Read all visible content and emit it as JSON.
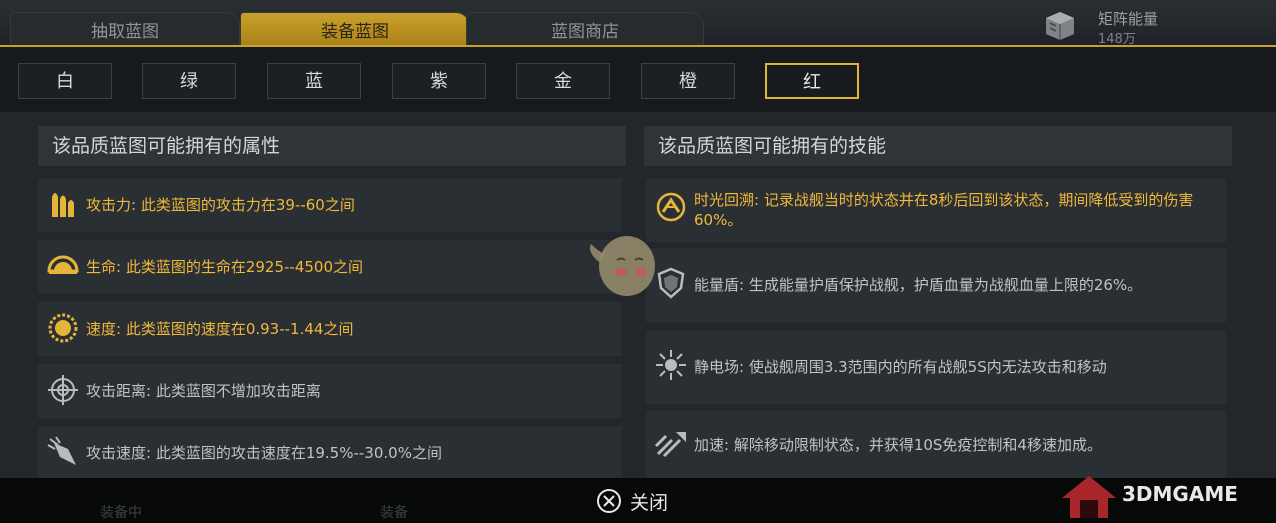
{
  "top_tabs": [
    {
      "label": "抽取蓝图",
      "active": false
    },
    {
      "label": "装备蓝图",
      "active": true
    },
    {
      "label": "蓝图商店",
      "active": false
    }
  ],
  "energy": {
    "label": "矩阵能量",
    "value": "148万",
    "icon": "energy-cube-icon"
  },
  "quality_tabs": [
    {
      "label": "白",
      "active": false
    },
    {
      "label": "绿",
      "active": false
    },
    {
      "label": "蓝",
      "active": false
    },
    {
      "label": "紫",
      "active": false
    },
    {
      "label": "金",
      "active": false
    },
    {
      "label": "橙",
      "active": false
    },
    {
      "label": "红",
      "active": true
    }
  ],
  "attributes": {
    "title": "该品质蓝图可能拥有的属性",
    "items": [
      {
        "icon": "bullets-icon",
        "text": "攻击力: 此类蓝图的攻击力在39--60之间",
        "highlight": true
      },
      {
        "icon": "life-icon",
        "text": "生命: 此类蓝图的生命在2925--4500之间",
        "highlight": true
      },
      {
        "icon": "speed-icon",
        "text": "速度: 此类蓝图的速度在0.93--1.44之间",
        "highlight": true
      },
      {
        "icon": "crosshair-icon",
        "text": "攻击距离: 此类蓝图不增加攻击距离",
        "highlight": false
      },
      {
        "icon": "rocket-icon",
        "text": "攻击速度: 此类蓝图的攻击速度在19.5%--30.0%之间",
        "highlight": false
      }
    ]
  },
  "skills": {
    "title": "该品质蓝图可能拥有的技能",
    "items": [
      {
        "icon": "time-rewind-icon",
        "text": "时光回溯: 记录战舰当时的状态并在8秒后回到该状态，期间降低受到的伤害60%。",
        "highlight": true
      },
      {
        "icon": "shield-icon",
        "text": "能量盾: 生成能量护盾保护战舰，护盾血量为战舰血量上限的26%。",
        "highlight": false
      },
      {
        "icon": "static-field-icon",
        "text": "静电场: 使战舰周围3.3范围内的所有战舰5S内无法攻击和移动",
        "highlight": false
      },
      {
        "icon": "accelerate-icon",
        "text": "加速: 解除移动限制状态，并获得10S免疫控制和4移速加成。",
        "highlight": false
      }
    ]
  },
  "close": {
    "label": "关闭",
    "icon": "close-circle-button-icon"
  },
  "background_labels": {
    "left": "装备中",
    "center": "装备"
  },
  "watermark": {
    "text": "3DMGAME"
  },
  "colors": {
    "accent": "#c9a12c",
    "highlight_text": "#f1b83a",
    "normal_text": "#bfc3c6"
  }
}
